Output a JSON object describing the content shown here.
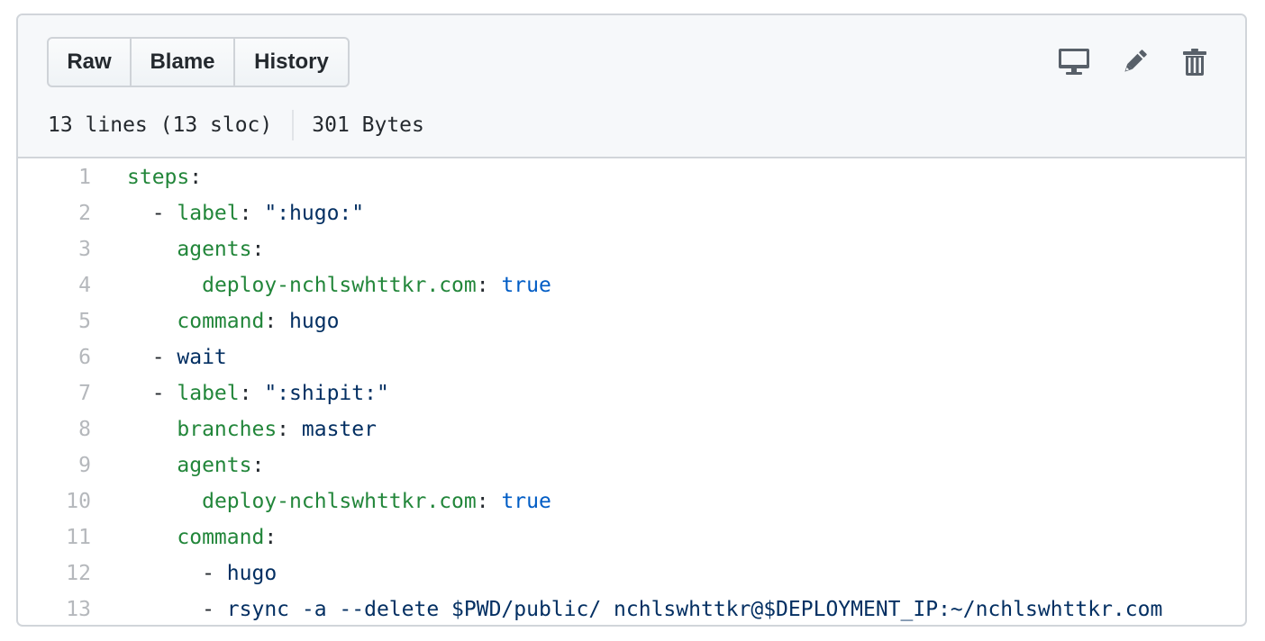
{
  "toolbar": {
    "buttons": [
      {
        "label": "Raw"
      },
      {
        "label": "Blame"
      },
      {
        "label": "History"
      }
    ],
    "actions": [
      {
        "icon": "desktop-icon",
        "label": "Open in desktop"
      },
      {
        "icon": "pencil-icon",
        "label": "Edit this file"
      },
      {
        "icon": "trash-icon",
        "label": "Delete this file"
      }
    ]
  },
  "file_info": {
    "lines": "13 lines (13 sloc)",
    "size": "301 Bytes"
  },
  "colors": {
    "key": "#22863a",
    "string": "#032f62",
    "boolean": "#005cc5",
    "punctuation": "#24292e",
    "line_number": "#b5b8bc",
    "header_bg": "#f6f8fa",
    "border": "#d1d5da"
  },
  "code": {
    "language": "yaml",
    "lines": [
      {
        "num": "1",
        "tokens": [
          {
            "t": "key",
            "v": "steps"
          },
          {
            "t": "punc",
            "v": ":"
          }
        ]
      },
      {
        "num": "2",
        "tokens": [
          {
            "t": "punc",
            "v": "  - "
          },
          {
            "t": "key",
            "v": "label"
          },
          {
            "t": "punc",
            "v": ": "
          },
          {
            "t": "str",
            "v": "\":hugo:\""
          }
        ]
      },
      {
        "num": "3",
        "tokens": [
          {
            "t": "punc",
            "v": "    "
          },
          {
            "t": "key",
            "v": "agents"
          },
          {
            "t": "punc",
            "v": ":"
          }
        ]
      },
      {
        "num": "4",
        "tokens": [
          {
            "t": "punc",
            "v": "      "
          },
          {
            "t": "key",
            "v": "deploy-nchlswhttkr.com"
          },
          {
            "t": "punc",
            "v": ": "
          },
          {
            "t": "bool",
            "v": "true"
          }
        ]
      },
      {
        "num": "5",
        "tokens": [
          {
            "t": "punc",
            "v": "    "
          },
          {
            "t": "key",
            "v": "command"
          },
          {
            "t": "punc",
            "v": ": "
          },
          {
            "t": "str",
            "v": "hugo"
          }
        ]
      },
      {
        "num": "6",
        "tokens": [
          {
            "t": "punc",
            "v": "  - "
          },
          {
            "t": "str",
            "v": "wait"
          }
        ]
      },
      {
        "num": "7",
        "tokens": [
          {
            "t": "punc",
            "v": "  - "
          },
          {
            "t": "key",
            "v": "label"
          },
          {
            "t": "punc",
            "v": ": "
          },
          {
            "t": "str",
            "v": "\":shipit:\""
          }
        ]
      },
      {
        "num": "8",
        "tokens": [
          {
            "t": "punc",
            "v": "    "
          },
          {
            "t": "key",
            "v": "branches"
          },
          {
            "t": "punc",
            "v": ": "
          },
          {
            "t": "str",
            "v": "master"
          }
        ]
      },
      {
        "num": "9",
        "tokens": [
          {
            "t": "punc",
            "v": "    "
          },
          {
            "t": "key",
            "v": "agents"
          },
          {
            "t": "punc",
            "v": ":"
          }
        ]
      },
      {
        "num": "10",
        "tokens": [
          {
            "t": "punc",
            "v": "      "
          },
          {
            "t": "key",
            "v": "deploy-nchlswhttkr.com"
          },
          {
            "t": "punc",
            "v": ": "
          },
          {
            "t": "bool",
            "v": "true"
          }
        ]
      },
      {
        "num": "11",
        "tokens": [
          {
            "t": "punc",
            "v": "    "
          },
          {
            "t": "key",
            "v": "command"
          },
          {
            "t": "punc",
            "v": ":"
          }
        ]
      },
      {
        "num": "12",
        "tokens": [
          {
            "t": "punc",
            "v": "      - "
          },
          {
            "t": "str",
            "v": "hugo"
          }
        ]
      },
      {
        "num": "13",
        "tokens": [
          {
            "t": "punc",
            "v": "      - "
          },
          {
            "t": "str",
            "v": "rsync -a --delete $PWD/public/ nchlswhttkr@$DEPLOYMENT_IP:~/nchlswhttkr.com"
          }
        ]
      }
    ]
  }
}
